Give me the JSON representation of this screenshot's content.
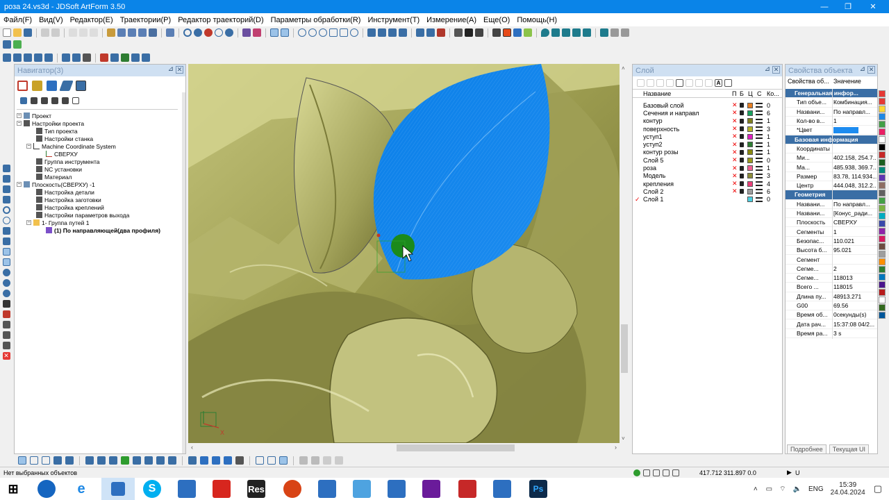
{
  "window": {
    "title": "роза 24.vs3d - JDSoft ArtForm 3.50"
  },
  "menu": [
    "Файл(F)",
    "Вид(V)",
    "Редактор(E)",
    "Траектории(P)",
    "Редактор траекторий(D)",
    "Параметры обработки(R)",
    "Инструмент(T)",
    "Измерение(A)",
    "Еще(O)",
    "Помощь(H)"
  ],
  "navigator": {
    "title": "Навигатор(3)",
    "tree": [
      "Проект",
      "Настройки проекта",
      "Тип проекта",
      "Настройки станка",
      "Machine Coordinate System",
      "СВЕРХУ",
      "Группа инструмента",
      "NC установки",
      "Материал",
      "Плоскость(СВЕРХУ) -1",
      "Настройка детали",
      "Настройка заготовки",
      "Настройка креплений",
      "Настройки параметров выхода",
      "1- Группа путей 1",
      "(1) По направляющей(два профиля)"
    ]
  },
  "viewport": {
    "axis_x": "X"
  },
  "layers": {
    "title": "Слой",
    "headers": {
      "name": "Название",
      "p": "П",
      "b": "Б",
      "c": "Ц",
      "s": "С",
      "count": "Ко..."
    },
    "rows": [
      {
        "name": "Базовый слой",
        "color": "#e67e22",
        "count": "0"
      },
      {
        "name": "Сечения и направл",
        "color": "#17a05d",
        "count": "6"
      },
      {
        "name": "контур",
        "color": "#7f7f20",
        "count": "1"
      },
      {
        "name": "поверхность",
        "color": "#b5b52a",
        "count": "3"
      },
      {
        "name": "уступ1",
        "color": "#e020c0",
        "count": "1"
      },
      {
        "name": "уступ2",
        "color": "#2e7d32",
        "count": "1"
      },
      {
        "name": "контур розы",
        "color": "#8a8a10",
        "count": "1"
      },
      {
        "name": "Слой 5",
        "color": "#9b9b1e",
        "count": "0"
      },
      {
        "name": "роза",
        "color": "#f06292",
        "count": "1"
      },
      {
        "name": "Модель",
        "color": "#8d8d3a",
        "count": "3"
      },
      {
        "name": "крепления",
        "color": "#ec407a",
        "count": "4"
      },
      {
        "name": "Слой 2",
        "color": "#9e9e9e",
        "count": "6"
      },
      {
        "name": "Слой 1",
        "color": "#4dd0e1",
        "count": "0"
      }
    ]
  },
  "properties": {
    "title": "Свойства объекта",
    "col1": "Свойства об...",
    "col2": "Значение",
    "rows": [
      {
        "type": "sec",
        "k": "Генеральная инфор..."
      },
      {
        "k": "Тип объе...",
        "v": "Комбинация..."
      },
      {
        "k": "Названи...",
        "v": "По направл..."
      },
      {
        "k": "Кол-во в...",
        "v": "1"
      },
      {
        "k": "*Цвет",
        "v": ""
      },
      {
        "type": "sec",
        "k": "Базовая информация"
      },
      {
        "k": "Координаты",
        "v": ""
      },
      {
        "k": "Ми...",
        "v": "402.158, 254.7..."
      },
      {
        "k": "Ма...",
        "v": "485.938, 369.7..."
      },
      {
        "k": "Размер",
        "v": "83.78, 114.934..."
      },
      {
        "k": "Центр",
        "v": "444.048, 312.2..."
      },
      {
        "type": "sec",
        "k": "Геометрия"
      },
      {
        "k": "Названи...",
        "v": "По направл..."
      },
      {
        "k": "Названи...",
        "v": "[Конус_ради..."
      },
      {
        "k": "Плоскость",
        "v": "СВЕРХУ"
      },
      {
        "k": "Сегменты",
        "v": "1"
      },
      {
        "k": "Безопас...",
        "v": "110.021"
      },
      {
        "k": "Высота б...",
        "v": "95.021"
      },
      {
        "k": "Сегмент",
        "v": ""
      },
      {
        "k": "Сегме...",
        "v": "2"
      },
      {
        "k": "Сегме...",
        "v": "118013"
      },
      {
        "k": "Всего ...",
        "v": "118015"
      },
      {
        "k": "Длина пу...",
        "v": "48913.271"
      },
      {
        "k": "G00",
        "v": "69.56"
      },
      {
        "k": "Время об...",
        "v": "0секунды(s)"
      },
      {
        "k": "Дата рач...",
        "v": "15:37:08 04/2..."
      },
      {
        "k": "Время ра...",
        "v": "3 s"
      }
    ],
    "btn_detail": "Подробнее",
    "btn_current": "Текущая UI"
  },
  "status": {
    "left": "Нет выбранных объектов",
    "coords": "417.712 311.897 0.0",
    "mode": "U"
  },
  "taskbar": {
    "time": "15:39",
    "date": "24.04.2024",
    "lang": "ENG",
    "res_label": "Res"
  },
  "colors": {
    "title_bar": "#0a84e8",
    "toolpath": "#1d8cf0",
    "model": "#a9a95a",
    "section": "#3a6ea5"
  }
}
